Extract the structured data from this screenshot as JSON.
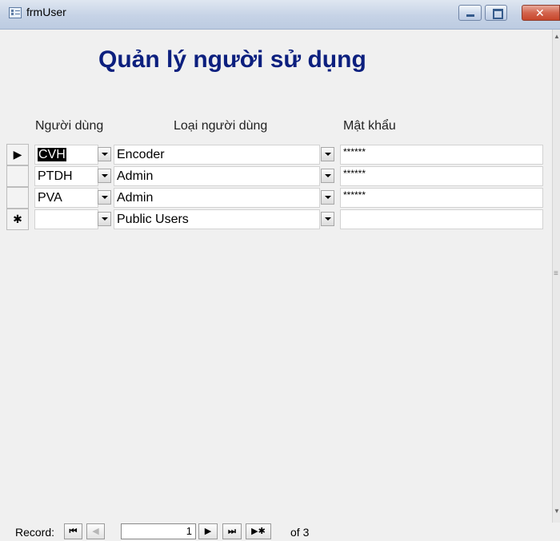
{
  "window": {
    "title": "frmUser",
    "controls": [
      "minimize",
      "maximize",
      "close"
    ]
  },
  "form": {
    "heading": "Quản lý người sử dụng",
    "columns": {
      "user": "Người dùng",
      "type": "Loại người dùng",
      "password": "Mật khẩu"
    },
    "rows": [
      {
        "selector": "▶",
        "user": "CVH",
        "type": "Encoder",
        "password": "******",
        "selected": true
      },
      {
        "selector": "",
        "user": "PTDH",
        "type": "Admin",
        "password": "******"
      },
      {
        "selector": "",
        "user": "PVA",
        "type": "Admin",
        "password": "******"
      },
      {
        "selector": "✱",
        "user": "",
        "type": "Public Users",
        "password": ""
      }
    ]
  },
  "record_nav": {
    "label": "Record:",
    "first": "⏮",
    "prev": "◀",
    "current": "1",
    "next": "▶",
    "last": "⏭",
    "new": "▶✱",
    "of_text": "of 3"
  }
}
